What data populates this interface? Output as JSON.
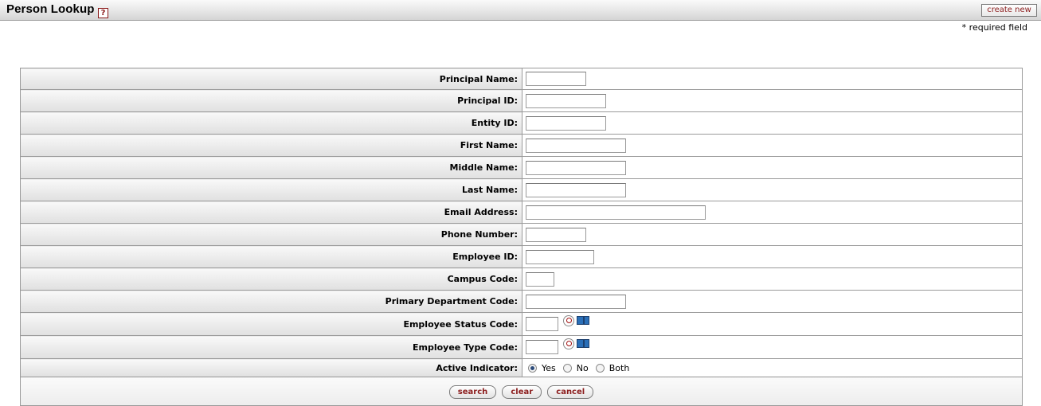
{
  "header": {
    "title": "Person Lookup",
    "help_icon_glyph": "?",
    "create_new_label": "create new"
  },
  "required_note": "* required field",
  "fields": [
    {
      "label": "Principal Name:",
      "value": ""
    },
    {
      "label": "Principal ID:",
      "value": ""
    },
    {
      "label": "Entity ID:",
      "value": ""
    },
    {
      "label": "First Name:",
      "value": ""
    },
    {
      "label": "Middle Name:",
      "value": ""
    },
    {
      "label": "Last Name:",
      "value": ""
    },
    {
      "label": "Email Address:",
      "value": ""
    },
    {
      "label": "Phone Number:",
      "value": ""
    },
    {
      "label": "Employee ID:",
      "value": ""
    },
    {
      "label": "Campus Code:",
      "value": ""
    },
    {
      "label": "Primary Department Code:",
      "value": ""
    },
    {
      "label": "Employee Status Code:",
      "value": "",
      "icons": [
        "lookup-icon",
        "inquiry-icon"
      ]
    },
    {
      "label": "Employee Type Code:",
      "value": "",
      "icons": [
        "lookup-icon",
        "inquiry-icon"
      ]
    }
  ],
  "active_indicator": {
    "label": "Active Indicator:",
    "options": [
      "Yes",
      "No",
      "Both"
    ],
    "selected": "Yes"
  },
  "buttons": {
    "search": "search",
    "clear": "clear",
    "cancel": "cancel"
  },
  "colors": {
    "button_text": "#8b1c1c",
    "border": "#9a9a9a"
  }
}
